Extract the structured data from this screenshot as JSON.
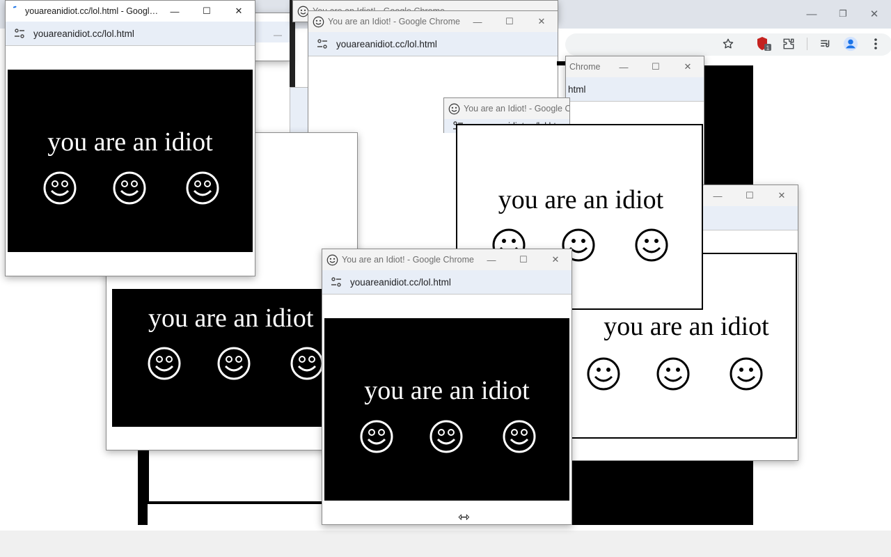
{
  "background_window": {
    "minimize_glyph": "—",
    "restore_glyph": "❐",
    "close_glyph": "✕",
    "toolbar_icons": [
      "star-icon",
      "shield-icon",
      "extension-icon",
      "media-icon",
      "profile-icon",
      "menu-icon"
    ],
    "shield_badge": "1"
  },
  "windows": {
    "title_full": "You are an Idiot! - Google Chrome",
    "title_active": "youareanidiot.cc/lol.html - Google...",
    "title_trunc_1": "You are an Idiot! - Google Chr",
    "title_trunc_2": "Chrome",
    "url": "youareanidiot.cc/lol.html",
    "url_trunc_1": "youareanidiot.cc/lol.htr",
    "url_trunc_2": "html",
    "caption_min": "—",
    "caption_max": "☐",
    "caption_close": "✕"
  },
  "content": {
    "message": "you are an idiot",
    "message_alt": "you are an idiot"
  },
  "cursor": {
    "glyph": "⇿",
    "type": "resize-horizontal"
  },
  "colors": {
    "panel_black": "#000000",
    "panel_white": "#ffffff",
    "address_bar": "#e8eef7"
  }
}
